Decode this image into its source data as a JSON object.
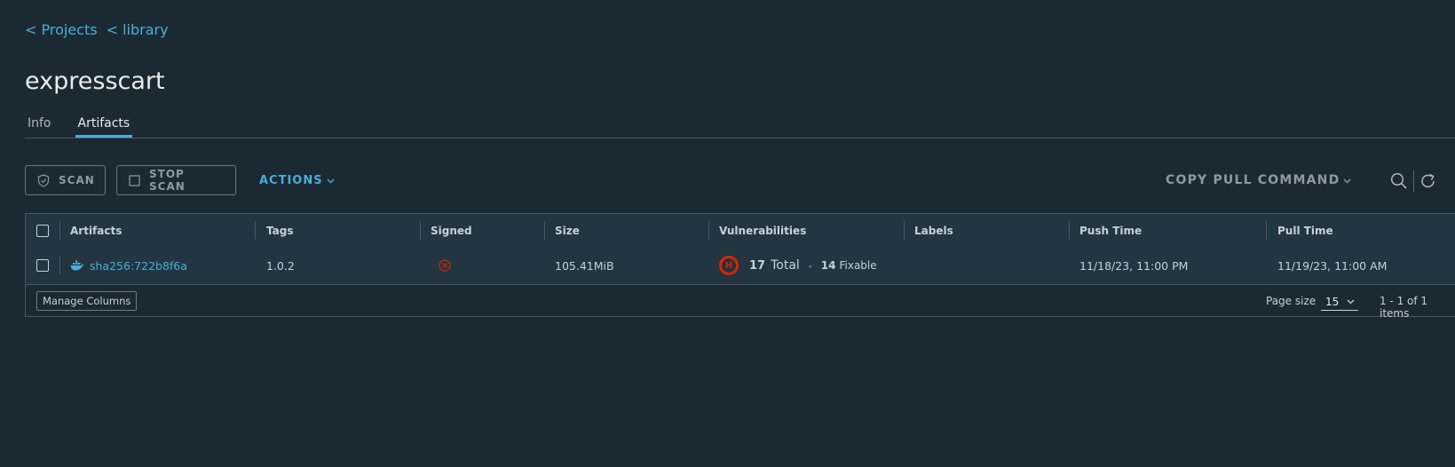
{
  "breadcrumbs": [
    {
      "label": "< Projects"
    },
    {
      "label": "< library"
    }
  ],
  "page_title": "expresscart",
  "tabs": [
    {
      "label": "Info",
      "active": false
    },
    {
      "label": "Artifacts",
      "active": true
    }
  ],
  "toolbar": {
    "scan_label": "SCAN",
    "stop_scan_label": "STOP SCAN",
    "actions_label": "ACTIONS",
    "copy_pull_label": "COPY PULL COMMAND"
  },
  "table": {
    "columns": [
      "Artifacts",
      "Tags",
      "Signed",
      "Size",
      "Vulnerabilities",
      "Labels",
      "Push Time",
      "Pull Time"
    ],
    "rows": [
      {
        "artifact": "sha256:722b8f6a",
        "tag": "1.0.2",
        "signed": "not-signed-icon",
        "size": "105.41MiB",
        "severity_letter": "H",
        "vuln_total_count": "17",
        "vuln_total_label": "Total",
        "vuln_sep": "-",
        "vuln_fixable_count": "14",
        "vuln_fixable_label": "Fixable",
        "labels": "",
        "push_time": "11/18/23, 11:00 PM",
        "pull_time": "11/19/23, 11:00 AM"
      }
    ]
  },
  "footer": {
    "manage_columns_label": "Manage Columns",
    "page_size_label": "Page size",
    "page_size_value": "15",
    "pager_info": "1 - 1 of 1 items"
  },
  "colors": {
    "background": "#1b2a32",
    "accent": "#49afd9",
    "severity_high": "#e12200"
  }
}
